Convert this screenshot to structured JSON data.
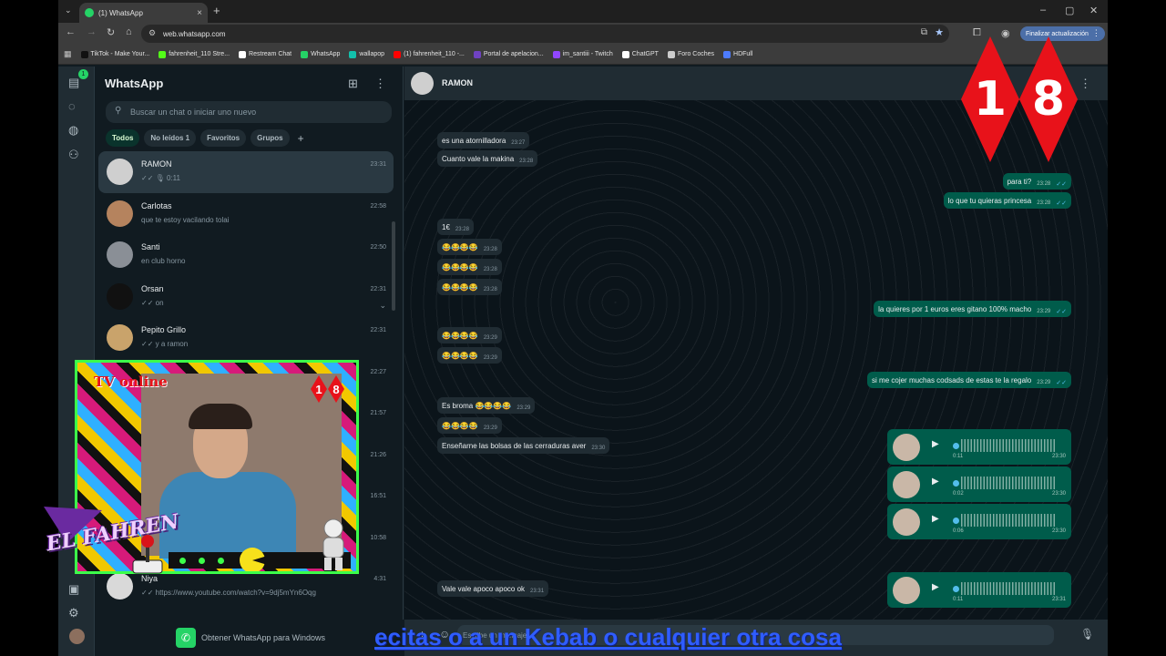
{
  "browser": {
    "tab_title": "(1) WhatsApp",
    "tab_close": "×",
    "new_tab": "+",
    "tab_dropdown": "⌄",
    "url": "web.whatsapp.com",
    "update_button": "Finalizar actualización",
    "window_controls": [
      "–",
      "▢",
      "✕"
    ],
    "bookmarks": [
      {
        "label": "TikTok - Make Your...",
        "color": "#111111"
      },
      {
        "label": "fahrenheit_110 Stre...",
        "color": "#53fc18"
      },
      {
        "label": "Restream Chat",
        "color": "#ffffff"
      },
      {
        "label": "WhatsApp",
        "color": "#25d366"
      },
      {
        "label": "wallapop",
        "color": "#13c1ac"
      },
      {
        "label": "(1) fahrenheit_110 -...",
        "color": "#ff0000"
      },
      {
        "label": "Portal de apelacion...",
        "color": "#6f42c1"
      },
      {
        "label": "im_santiii - Twitch",
        "color": "#9146ff"
      },
      {
        "label": "ChatGPT",
        "color": "#ffffff"
      },
      {
        "label": "Foro Coches",
        "color": "#cccccc"
      },
      {
        "label": "HDFull",
        "color": "#4d7cff"
      }
    ]
  },
  "rail": {
    "unread_badge": "1"
  },
  "sidebar": {
    "title": "WhatsApp",
    "search_placeholder": "Buscar un chat o iniciar uno nuevo",
    "filters": [
      "Todos",
      "No leídos 1",
      "Favoritos",
      "Grupos"
    ],
    "chats": [
      {
        "name": "RAMON",
        "preview": "✓✓ 🎙 0:11",
        "time": "23:31",
        "avatar_color": "#cfcfcf"
      },
      {
        "name": "Carlotas",
        "preview": "que te estoy vacilando tolai",
        "time": "22:58",
        "avatar_color": "#b5835e"
      },
      {
        "name": "Santi",
        "preview": "en club horno",
        "time": "22:50",
        "avatar_color": "#8a8f96"
      },
      {
        "name": "Orsan",
        "preview": "✓✓ on",
        "time": "22:31",
        "avatar_color": "#111111"
      },
      {
        "name": "Pepito Grillo",
        "preview": "✓✓ y a ramon",
        "time": "22:31",
        "avatar_color": "#c9a36b"
      },
      {
        "name": "",
        "preview": "",
        "time": "22:27",
        "avatar_color": "#555555"
      },
      {
        "name": "",
        "preview": "",
        "time": "21:57",
        "avatar_color": "#555555"
      },
      {
        "name": "",
        "preview": "",
        "time": "21:26",
        "avatar_color": "#555555"
      },
      {
        "name": "",
        "preview": "",
        "time": "16:51",
        "avatar_color": "#555555"
      },
      {
        "name": "",
        "preview": "",
        "time": "10:58",
        "avatar_color": "#555555"
      },
      {
        "name": "Niya",
        "preview": "✓✓ https://www.youtube.com/watch?v=9dj5mYn6Oqg",
        "time": "4:31",
        "avatar_color": "#d9d9d9"
      }
    ],
    "download_label": "Obtener WhatsApp para Windows"
  },
  "overlay": {
    "tv_label": "TV online",
    "rating": [
      "1",
      "8"
    ],
    "brand": "EL FAHREN"
  },
  "chat": {
    "contact": "RAMON",
    "messages": [
      {
        "dir": "in",
        "text": "es una atornilladora",
        "time": "23:27"
      },
      {
        "dir": "in",
        "text": "Cuanto vale la makina",
        "time": "23:28"
      },
      {
        "dir": "out",
        "text": "para ti?",
        "time": "23:28"
      },
      {
        "dir": "out",
        "text": "lo que tu quieras princesa",
        "time": "23:28"
      },
      {
        "dir": "in",
        "text": "1€",
        "time": "23:28"
      },
      {
        "dir": "in",
        "text": "😂😂😂😂",
        "time": "23:28"
      },
      {
        "dir": "in",
        "text": "😂😂😂😂",
        "time": "23:28"
      },
      {
        "dir": "in",
        "text": "😂😂😂😂",
        "time": "23:28"
      },
      {
        "dir": "out",
        "text": "la quieres por 1 euros eres gitano 100% macho",
        "time": "23:29"
      },
      {
        "dir": "in",
        "text": "😂😂😂😂",
        "time": "23:29"
      },
      {
        "dir": "in",
        "text": "😂😂😂😂",
        "time": "23:29"
      },
      {
        "dir": "out",
        "text": "si me cojer muchas codsads de estas te la regalo",
        "time": "23:29"
      },
      {
        "dir": "in",
        "text": "Es broma 😂😂😂😂",
        "time": "23:29"
      },
      {
        "dir": "in",
        "text": "😂😂😂😂",
        "time": "23:29"
      },
      {
        "dir": "in",
        "text": "Enseñarne las bolsas de las cerraduras aver",
        "time": "23:30"
      },
      {
        "dir": "in",
        "text": "Vale vale apoco apoco ok",
        "time": "23:31"
      }
    ],
    "voice_notes": [
      {
        "duration": "0:11",
        "time": "23:30",
        "progress": 0
      },
      {
        "duration": "0:02",
        "time": "23:30",
        "progress": 0
      },
      {
        "duration": "0:06",
        "time": "23:30",
        "progress": 0
      },
      {
        "duration": "0:11",
        "time": "23:31",
        "progress": 0
      }
    ],
    "composer_placeholder": "Escribe un mensaje",
    "rating_logo": [
      "1",
      "8"
    ]
  },
  "stream_ticker": "ecitas o a un Kebab o cualquier otra cosa"
}
